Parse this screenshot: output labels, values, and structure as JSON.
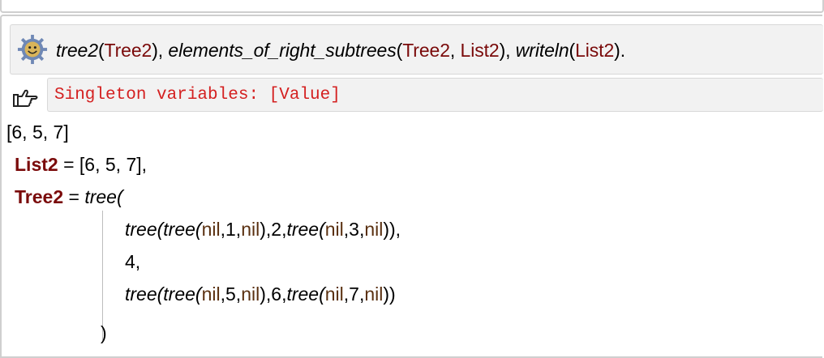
{
  "query": {
    "icon": "swish-gear-smiley-icon",
    "goal1_name": "tree2",
    "goal1_arg": "Tree2",
    "goal2_name": "elements_of_right_subtrees",
    "goal2_arg1": "Tree2",
    "goal2_arg2": "List2",
    "goal3_name": "writeln",
    "goal3_arg": "List2"
  },
  "warning": {
    "icon": "pointing-hand-icon",
    "text": "Singleton variables: [Value]"
  },
  "output": {
    "printed": "[6, 5, 7]",
    "list2_var": "List2",
    "list2_value": "[6, 5, 7],",
    "tree2_var": "Tree2",
    "tree2_functor": "tree(",
    "line1": {
      "t1": "tree(",
      "t2": "tree(",
      "n1": "nil",
      "v1": "1",
      "n2": "nil",
      "v2": "2",
      "t3": "tree(",
      "n3": "nil",
      "v3": "3",
      "n4": "nil"
    },
    "line2": "4,",
    "line3": {
      "t1": "tree(",
      "t2": "tree(",
      "n1": "nil",
      "v1": "5",
      "n2": "nil",
      "v2": "6",
      "t3": "tree(",
      "n3": "nil",
      "v3": "7",
      "n4": "nil"
    },
    "close": ")"
  }
}
